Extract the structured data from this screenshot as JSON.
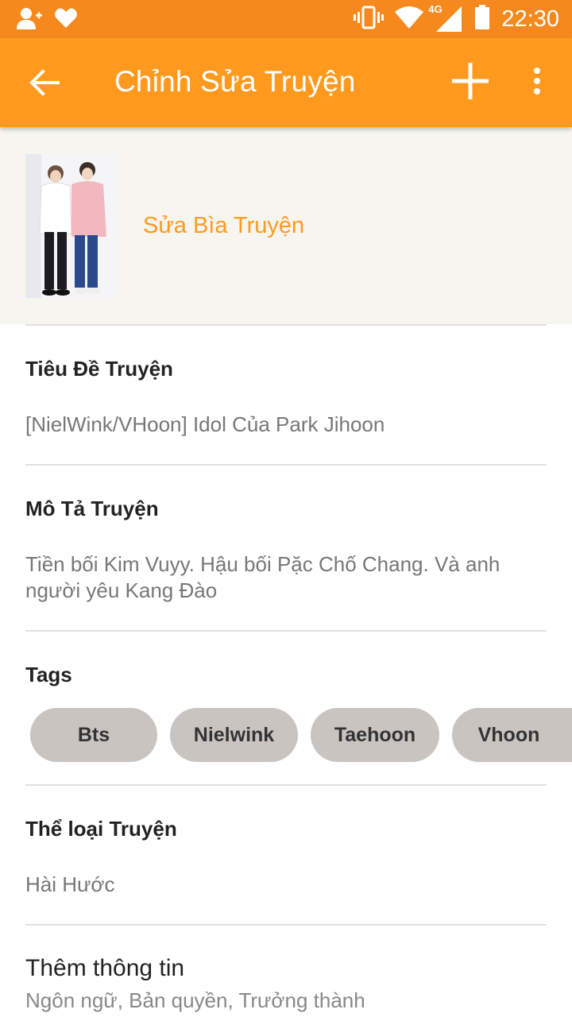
{
  "status_bar": {
    "time": "22:30",
    "network": "4G",
    "icons": [
      "add-friend-icon",
      "heart-icon",
      "vibrate-icon",
      "wifi-icon",
      "signal-icon",
      "battery-icon"
    ]
  },
  "app_bar": {
    "title": "Chỉnh Sửa Truyện",
    "icons": [
      "back-arrow-icon",
      "add-icon",
      "more-vert-icon"
    ]
  },
  "cover": {
    "edit_label": "Sửa Bìa Truyện"
  },
  "fields": {
    "title": {
      "label": "Tiêu Đề Truyện",
      "value": "[NielWink/VHoon] Idol Của Park Jihoon"
    },
    "description": {
      "label": "Mô Tả Truyện",
      "value": "Tiền bối Kim Vuyy. Hậu bối Pặc Chố Chang. Và anh người yêu Kang Đào"
    },
    "tags": {
      "label": "Tags",
      "items": [
        "Bts",
        "Nielwink",
        "Taehoon",
        "Vhoon"
      ]
    },
    "genre": {
      "label": "Thể loại Truyện",
      "value": "Hài Hước"
    }
  },
  "more_info": {
    "title": "Thêm thông tin",
    "subtitle": "Ngôn ngữ, Bản quyền, Trưởng thành"
  },
  "colors": {
    "status_bar": "#f5891e",
    "app_bar": "#ff9a1f",
    "accent": "#ff9a1f",
    "chip": "#c9c4c0"
  }
}
